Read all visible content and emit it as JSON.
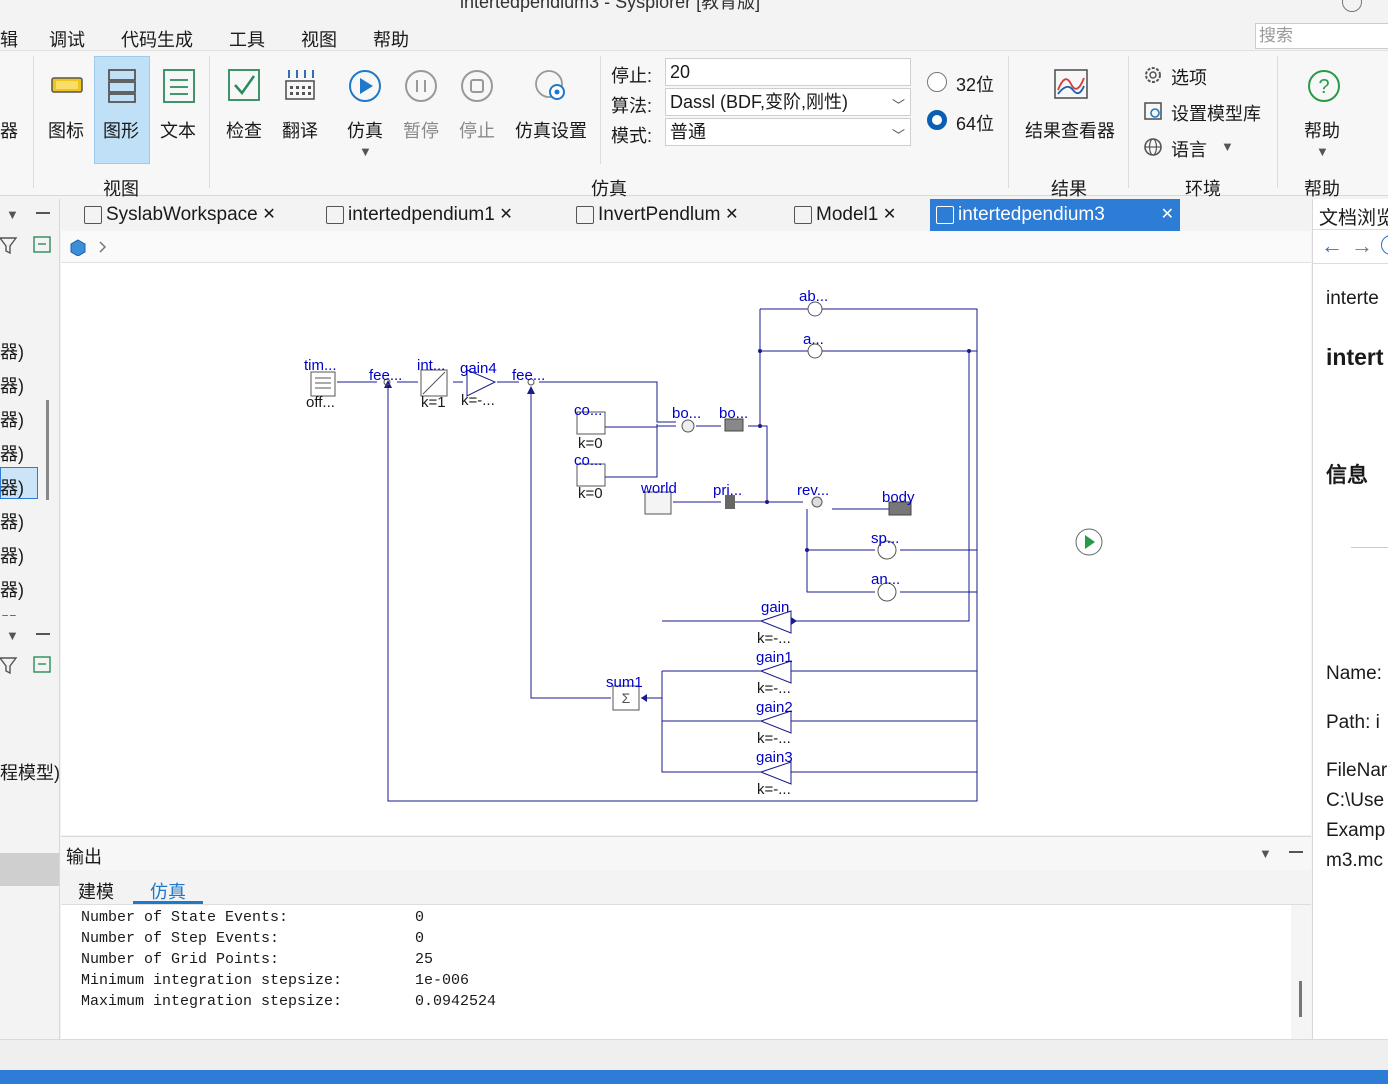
{
  "window": {
    "title": "intertedpendium3 - Sysplorer [教育版]"
  },
  "menu": {
    "items": [
      "辑",
      "调试",
      "代码生成",
      "工具",
      "视图",
      "帮助"
    ],
    "search_placeholder": "搜索"
  },
  "ribbon": {
    "view_group": {
      "label": "视图",
      "cut_label": "器",
      "icon_label": "图标",
      "graphic_label": "图形",
      "text_label": "文本"
    },
    "sim_group": {
      "label": "仿真",
      "check_label": "检查",
      "translate_label": "翻译",
      "simulate_label": "仿真",
      "pause_label": "暂停",
      "stop_label": "停止",
      "settings_label": "仿真设置",
      "stop_time_label": "停止:",
      "stop_time_value": "20",
      "algorithm_label": "算法:",
      "algorithm_value": "Dassl (BDF,变阶,刚性)",
      "mode_label": "模式:",
      "mode_value": "普通",
      "bit32_label": "32位",
      "bit64_label": "64位",
      "selected_bits": "64位"
    },
    "result_group": {
      "label": "结果",
      "viewer_label": "结果查看器"
    },
    "env_group": {
      "label": "环境",
      "options_label": "选项",
      "model_lib_label": "设置模型库",
      "language_label": "语言"
    },
    "help_group": {
      "label": "帮助",
      "help_label": "帮助"
    }
  },
  "tabs": [
    {
      "label": "SyslabWorkspace",
      "active": false
    },
    {
      "label": "intertedpendium1",
      "active": false
    },
    {
      "label": "InvertPendlum",
      "active": false
    },
    {
      "label": "Model1",
      "active": false
    },
    {
      "label": "intertedpendium3",
      "active": true
    }
  ],
  "left_panel": {
    "items": [
      "器)",
      "器)",
      "器)",
      "器)",
      "器)",
      "器)",
      "器)",
      "器)",
      "器)",
      "程模型)"
    ]
  },
  "diagram": {
    "blocks": {
      "timetable": "tim...",
      "timetable_param": "off...",
      "feedback1": "fee...",
      "integrator": "int...",
      "integrator_param": "k=1",
      "gain4": "gain4",
      "gain4_param": "k=-...",
      "feedback2": "fee...",
      "const1": "co...",
      "const1_param": "k=0",
      "const2": "co...",
      "const2_param": "k=0",
      "body_force": "bo...",
      "body_shape": "bo...",
      "world": "world",
      "prismatic": "pri...",
      "revolute": "rev...",
      "body": "body",
      "abs_sensor": "ab...",
      "a_sensor": "a...",
      "speed_sensor": "sp...",
      "angle_sensor": "an...",
      "gain": "gain",
      "gain_param": "k=-...",
      "gain1": "gain1",
      "gain1_param": "k=-...",
      "gain2": "gain2",
      "gain2_param": "k=-...",
      "gain3": "gain3",
      "gain3_param": "k=-...",
      "sum1": "sum1"
    }
  },
  "right_panel": {
    "title": "文档浏览",
    "heading1": "interte",
    "heading2": "intert",
    "info": "信息",
    "name": "Name:",
    "path": "Path: i",
    "filename": "FileNar",
    "file1": "C:\\Use",
    "file2": "Examp",
    "file3": "m3.mc"
  },
  "output": {
    "title": "输出",
    "tabs": [
      "建模",
      "仿真"
    ],
    "active_tab": "仿真",
    "lines": [
      {
        "key": "Number of State Events:",
        "value": "0"
      },
      {
        "key": "Number of Step Events:",
        "value": "0"
      },
      {
        "key": "Number of Grid Points:",
        "value": "25"
      },
      {
        "key": "Minimum integration stepsize:",
        "value": "1e-006"
      },
      {
        "key": "Maximum integration stepsize:",
        "value": "0.0942524"
      }
    ]
  },
  "colors": {
    "accent": "#2d7cd6",
    "diagram_line": "#1a1a8c",
    "diagram_text": "#0000c8"
  }
}
